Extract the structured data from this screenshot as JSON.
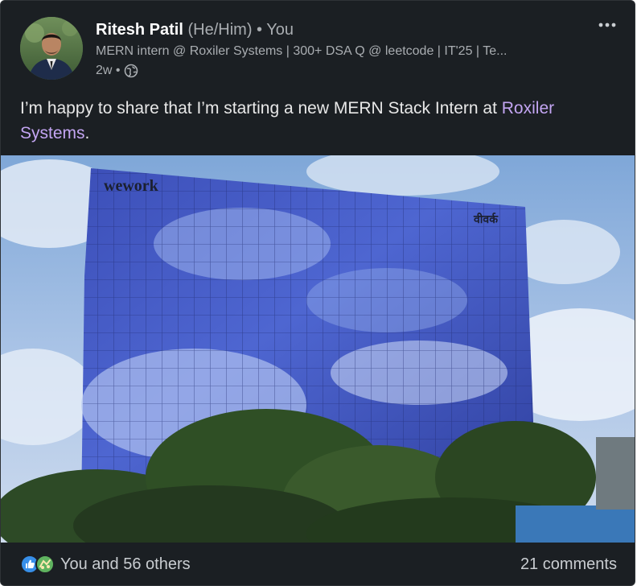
{
  "post": {
    "author": {
      "name": "Ritesh Patil",
      "pronouns": "(He/Him)",
      "separator": " • ",
      "relation": "You",
      "headline": "MERN intern @ Roxiler Systems | 300+ DSA Q @ leetcode | IT'25 | Te...",
      "time": "2w •",
      "visibility_icon": "globe-icon",
      "avatar_icon": "profile-photo"
    },
    "more_icon": "more-options-icon",
    "text_before": "I’m happy to share that I’m starting a new MERN Stack Intern at ",
    "mention": "Roxiler Systems",
    "text_after": ".",
    "image": {
      "sign_left": "wework",
      "sign_right": "वीवर्क"
    },
    "reactions": {
      "icons": [
        "like-icon",
        "celebrate-icon"
      ],
      "label": "You and 56 others"
    },
    "comments_label": "21 comments"
  },
  "colors": {
    "background": "#1b1f23",
    "mention": "#c3a5f2",
    "text": "#e8e8e8",
    "secondary_text": "#a9adb1"
  }
}
